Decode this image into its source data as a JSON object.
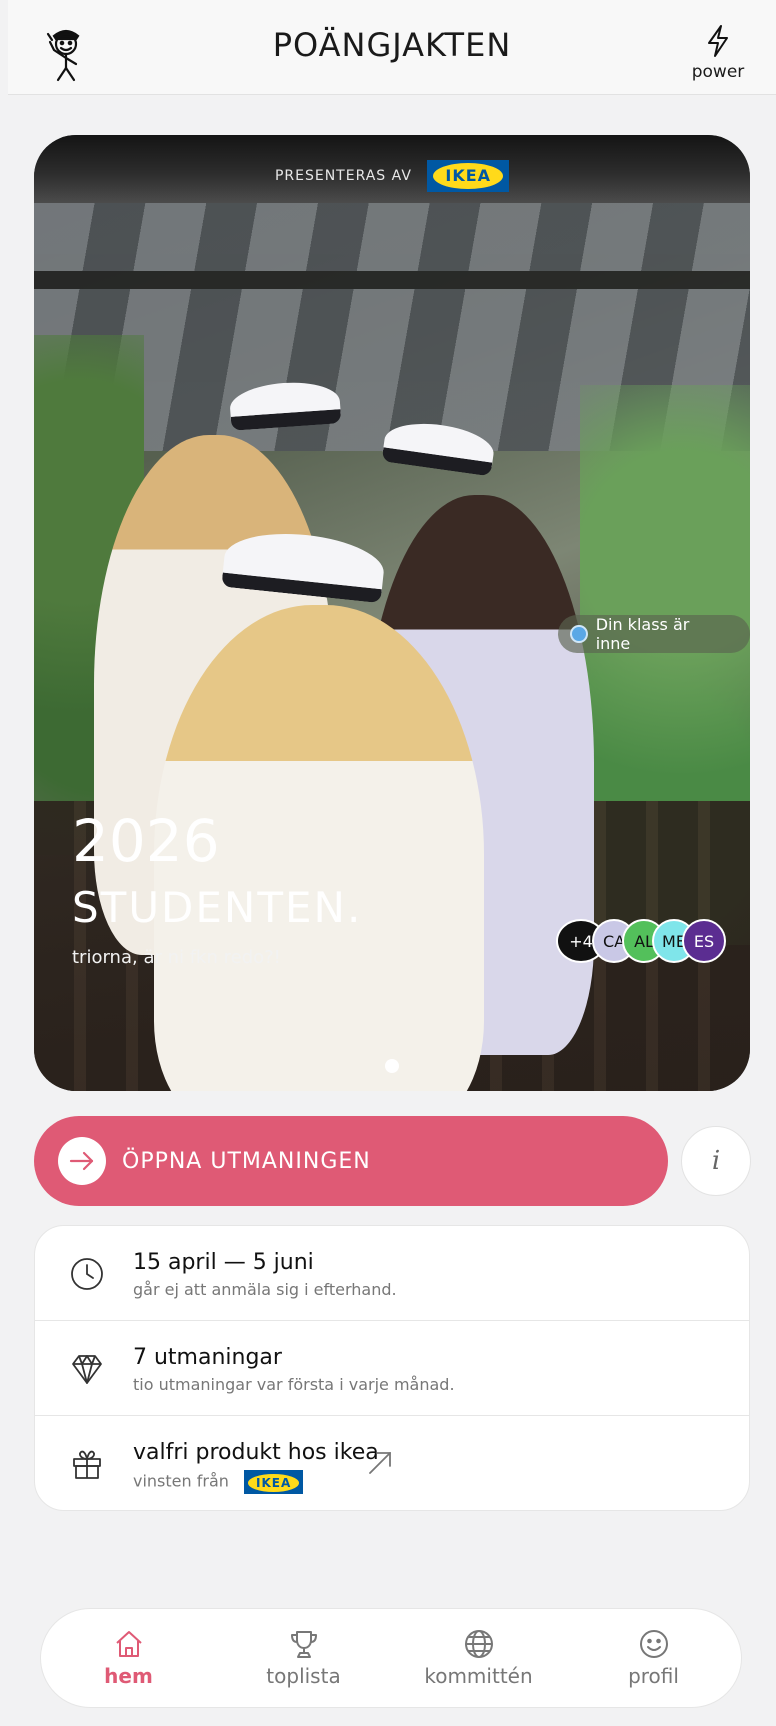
{
  "header": {
    "title": "POÄNGJAKTEN",
    "power_label": "power"
  },
  "hero": {
    "presented_by": "PRESENTERAS AV",
    "sponsor_logo_text": "IKEA",
    "class_status": "Din klass är inne",
    "year": "2026",
    "headline": "STUDENTEN.",
    "tagline": "triorna, är ni fkn redo?!",
    "avatars": [
      {
        "label": "+4",
        "color": "#111111"
      },
      {
        "label": "CA",
        "color": "#c9c8e6"
      },
      {
        "label": "AL",
        "color": "#53c05b"
      },
      {
        "label": "ME",
        "color": "#7fe5ea"
      },
      {
        "label": "ES",
        "color": "#5b2d91"
      }
    ],
    "carousel_page": 1,
    "carousel_total": 1
  },
  "cta": {
    "label": "ÖPPNA UTMANINGEN",
    "info_label": "i"
  },
  "info": [
    {
      "icon": "clock-icon",
      "title": "15 april — 5 juni",
      "subtitle": "går ej att anmäla sig i efterhand."
    },
    {
      "icon": "diamond-icon",
      "title": "7 utmaningar",
      "subtitle": "tio utmaningar var första i varje månad."
    },
    {
      "icon": "gift-icon",
      "title": "valfri produkt hos ikea",
      "subtitle": "vinsten från",
      "logo_text": "IKEA"
    }
  ],
  "nav": [
    {
      "label": "hem",
      "icon": "home-icon",
      "active": true
    },
    {
      "label": "toplista",
      "icon": "trophy-icon",
      "active": false
    },
    {
      "label": "kommittén",
      "icon": "globe-icon",
      "active": false
    },
    {
      "label": "profil",
      "icon": "smiley-icon",
      "active": false
    }
  ],
  "colors": {
    "accent": "#df5a75",
    "ikea_blue": "#0058a3",
    "ikea_yellow": "#ffda1a"
  }
}
